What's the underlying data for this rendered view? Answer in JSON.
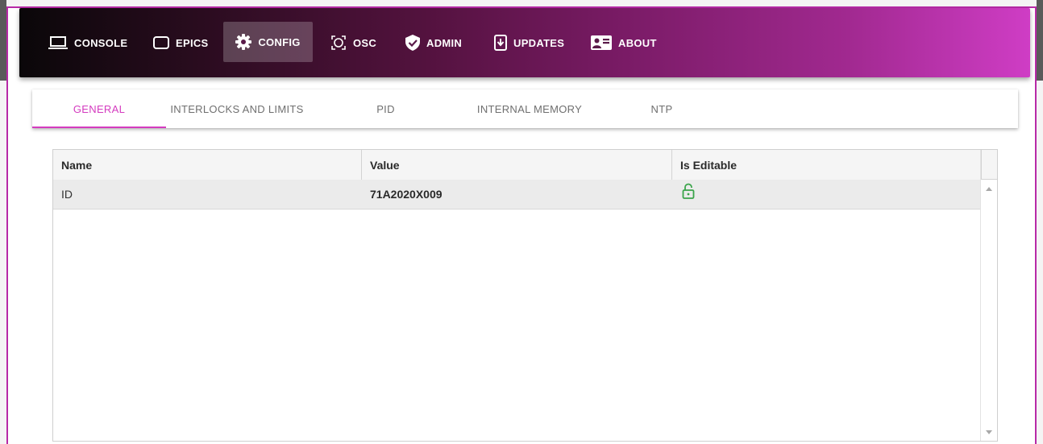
{
  "nav": {
    "items": [
      {
        "label": "CONSOLE",
        "icon": "laptop-icon"
      },
      {
        "label": "EPICS",
        "icon": "rounded-rectangle-icon"
      },
      {
        "label": "CONFIG",
        "icon": "gear-icon"
      },
      {
        "label": "OSC",
        "icon": "scan-frame-icon"
      },
      {
        "label": "ADMIN",
        "icon": "shield-check-icon"
      },
      {
        "label": "UPDATES",
        "icon": "download-box-icon"
      },
      {
        "label": "ABOUT",
        "icon": "contact-card-icon"
      }
    ],
    "active": "CONFIG"
  },
  "tabs": {
    "items": [
      "GENERAL",
      "INTERLOCKS AND LIMITS",
      "PID",
      "INTERNAL MEMORY",
      "NTP"
    ],
    "active": "GENERAL",
    "accent_color": "#d43bbf"
  },
  "grid": {
    "columns": [
      "Name",
      "Value",
      "Is Editable"
    ],
    "rows": [
      {
        "name": "ID",
        "value": "71A2020X009",
        "editable_icon": "unlocked-padlock-icon"
      }
    ],
    "unlock_color": "#3aa44a"
  }
}
